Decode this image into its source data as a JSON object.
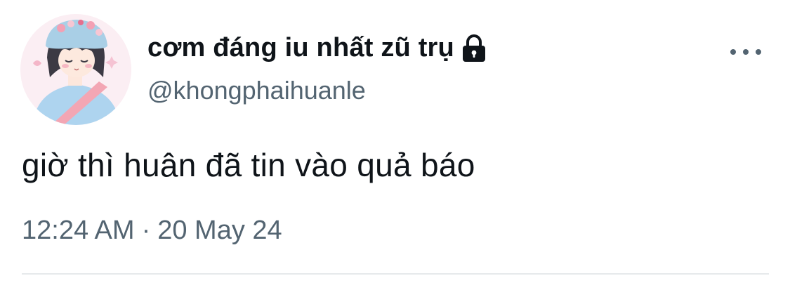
{
  "tweet": {
    "display_name": "cơm đáng iu nhất zũ trụ",
    "handle": "@khongphaihuanle",
    "text": "giờ thì huân đã tin vào quả báo",
    "time": "12:24 AM",
    "separator": "·",
    "date": "20 May 24",
    "avatar_icon": "avatar-image",
    "lock_icon": "lock-icon",
    "more_icon": "more-options-icon"
  },
  "colors": {
    "text_primary": "#0f1419",
    "text_secondary": "#536471",
    "divider": "#e6e9eb"
  }
}
